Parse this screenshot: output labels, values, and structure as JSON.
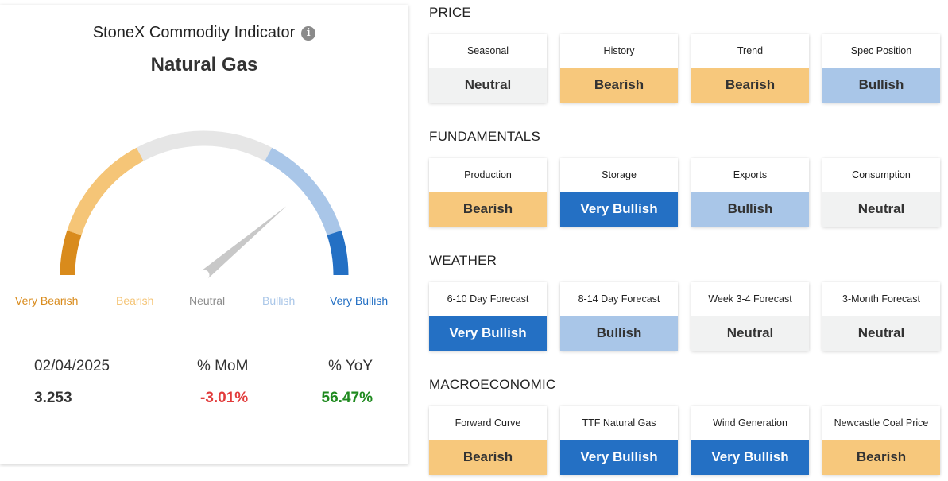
{
  "indicator": {
    "title": "StoneX Commodity Indicator",
    "commodity": "Natural Gas",
    "info_icon": "info-icon",
    "reading": "Bullish",
    "scale": [
      {
        "label": "Very Bearish",
        "color": "#d98b1c"
      },
      {
        "label": "Bearish",
        "color": "#f5c577"
      },
      {
        "label": "Neutral",
        "color": "#8c8c8c"
      },
      {
        "label": "Bullish",
        "color": "#a9c6e8"
      },
      {
        "label": "Very Bullish",
        "color": "#2470c4"
      }
    ]
  },
  "stats": {
    "date": "02/04/2025",
    "mom_label": "% MoM",
    "yoy_label": "% YoY",
    "price": "3.253",
    "mom": "-3.01%",
    "yoy": "56.47%",
    "mom_color": "#e23c3c",
    "yoy_color": "#1f8a1f"
  },
  "sections": [
    {
      "title": "PRICE",
      "items": [
        {
          "label": "Seasonal",
          "value": "Neutral"
        },
        {
          "label": "History",
          "value": "Bearish"
        },
        {
          "label": "Trend",
          "value": "Bearish"
        },
        {
          "label": "Spec Position",
          "value": "Bullish"
        }
      ]
    },
    {
      "title": "FUNDAMENTALS",
      "items": [
        {
          "label": "Production",
          "value": "Bearish"
        },
        {
          "label": "Storage",
          "value": "Very Bullish"
        },
        {
          "label": "Exports",
          "value": "Bullish"
        },
        {
          "label": "Consumption",
          "value": "Neutral"
        }
      ]
    },
    {
      "title": "WEATHER",
      "items": [
        {
          "label": "6-10 Day Forecast",
          "value": "Very Bullish"
        },
        {
          "label": "8-14 Day Forecast",
          "value": "Bullish"
        },
        {
          "label": "Week 3-4 Forecast",
          "value": "Neutral"
        },
        {
          "label": "3-Month Forecast",
          "value": "Neutral"
        }
      ]
    },
    {
      "title": "MACROECONOMIC",
      "items": [
        {
          "label": "Forward Curve",
          "value": "Bearish"
        },
        {
          "label": "TTF Natural Gas",
          "value": "Very Bullish"
        },
        {
          "label": "Wind Generation",
          "value": "Very Bullish"
        },
        {
          "label": "Newcastle Coal Price",
          "value": "Bearish"
        }
      ]
    }
  ],
  "value_styles": {
    "Very Bearish": {
      "bg": "#d98b1c",
      "fg": "#ffffff"
    },
    "Bearish": {
      "bg": "#f7c87c",
      "fg": "#333333"
    },
    "Neutral": {
      "bg": "#f1f2f2",
      "fg": "#333333"
    },
    "Bullish": {
      "bg": "#a9c6e8",
      "fg": "#333333"
    },
    "Very Bullish": {
      "bg": "#2470c4",
      "fg": "#ffffff"
    }
  }
}
